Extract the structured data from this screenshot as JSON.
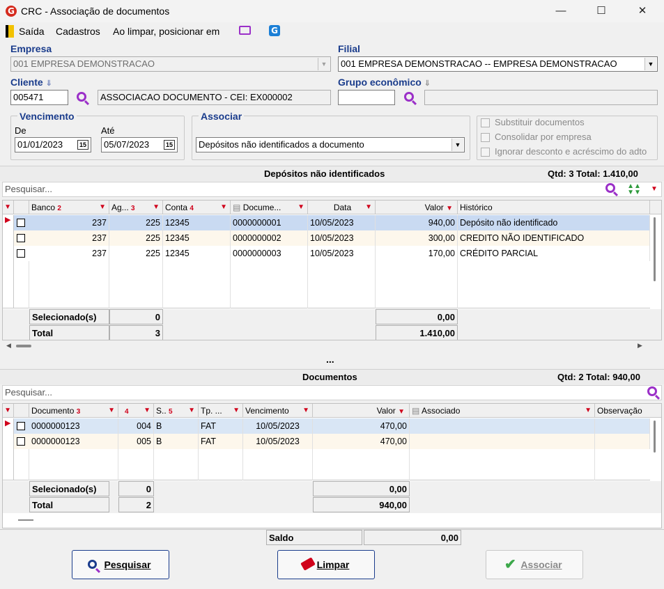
{
  "window": {
    "title": "CRC - Associação de documentos"
  },
  "menu": {
    "saida": "Saída",
    "cadastros": "Cadastros",
    "ao_limpar": "Ao limpar, posicionar em"
  },
  "empresa": {
    "label": "Empresa",
    "value": "001 EMPRESA DEMONSTRACAO"
  },
  "filial": {
    "label": "Filial",
    "value": "001 EMPRESA DEMONSTRACAO -- EMPRESA DEMONSTRACAO"
  },
  "cliente": {
    "label": "Cliente",
    "code": "005471",
    "name": "ASSOCIACAO DOCUMENTO - CEI: EX000002"
  },
  "grupo": {
    "label": "Grupo econômico",
    "code": "",
    "name": ""
  },
  "vencimento": {
    "label": "Vencimento",
    "de_label": "De",
    "de": "01/01/2023",
    "ate_label": "Até",
    "ate": "05/07/2023",
    "cal_icon": "15"
  },
  "associar": {
    "label": "Associar",
    "value": "Depósitos não identificados a documento"
  },
  "options": {
    "substituir": "Substituir documentos",
    "consolidar": "Consolidar por empresa",
    "ignorar": "Ignorar desconto e acréscimo do adto"
  },
  "depositos": {
    "title": "Depósitos não identificados",
    "summary": "Qtd: 3 Total: 1.410,00",
    "search_placeholder": "Pesquisar...",
    "columns": {
      "banco": "Banco",
      "banco_sort": "2",
      "ag": "Ag...",
      "ag_sort": "3",
      "conta": "Conta",
      "conta_sort": "4",
      "documento": "Docume...",
      "data": "Data",
      "valor": "Valor",
      "historico": "Histórico"
    },
    "rows": [
      {
        "banco": "237",
        "ag": "225",
        "conta": "12345",
        "documento": "0000000001",
        "data": "10/05/2023",
        "valor": "940,00",
        "historico": "Depósito não identificado"
      },
      {
        "banco": "237",
        "ag": "225",
        "conta": "12345",
        "documento": "0000000002",
        "data": "10/05/2023",
        "valor": "300,00",
        "historico": "CREDITO NÃO IDENTIFICADO"
      },
      {
        "banco": "237",
        "ag": "225",
        "conta": "12345",
        "documento": "0000000003",
        "data": "10/05/2023",
        "valor": "170,00",
        "historico": "CRÉDITO PARCIAL"
      }
    ],
    "selected_label": "Selecionado(s)",
    "selected_count": "0",
    "selected_value": "0,00",
    "total_label": "Total",
    "total_count": "3",
    "total_value": "1.410,00"
  },
  "splitter": "...",
  "documentos": {
    "title": "Documentos",
    "summary": "Qtd: 2 Total: 940,00",
    "search_placeholder": "Pesquisar...",
    "columns": {
      "documento": "Documento",
      "documento_sort": "3",
      "c4_sort": "4",
      "s": "S..",
      "s_sort": "5",
      "tp": "Tp. ...",
      "vencimento": "Vencimento",
      "valor": "Valor",
      "associado": "Associado",
      "observacao": "Observação"
    },
    "rows": [
      {
        "documento": "0000000123",
        "c4": "004",
        "s": "B",
        "tp": "FAT",
        "vencimento": "10/05/2023",
        "valor": "470,00"
      },
      {
        "documento": "0000000123",
        "c4": "005",
        "s": "B",
        "tp": "FAT",
        "vencimento": "10/05/2023",
        "valor": "470,00"
      }
    ],
    "selected_label": "Selecionado(s)",
    "selected_count": "0",
    "selected_value": "0,00",
    "total_label": "Total",
    "total_count": "2",
    "total_value": "940,00"
  },
  "saldo": {
    "label": "Saldo",
    "value": "0,00"
  },
  "buttons": {
    "pesquisar": "Pesquisar",
    "limpar": "Limpar",
    "associar": "Associar"
  },
  "colors": {
    "accent": "#1a3c8c",
    "filter": "#d0021b",
    "search_icon": "#9b30c8",
    "selected_row": "#c9daf2"
  }
}
